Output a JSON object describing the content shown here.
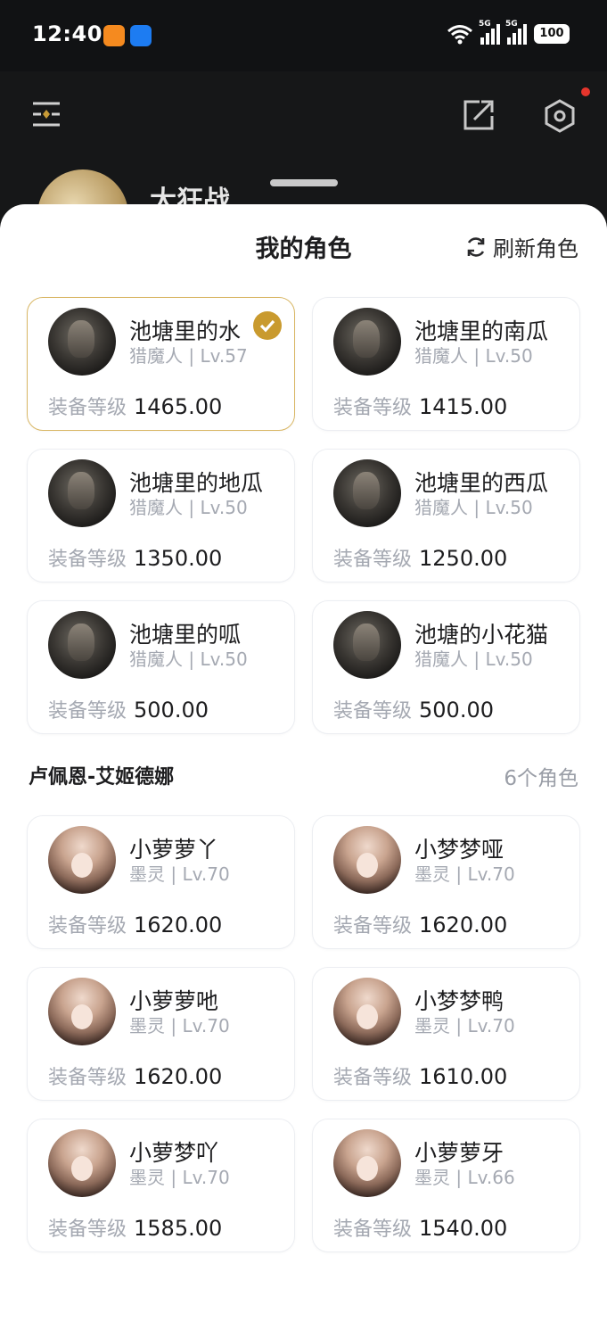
{
  "status_bar": {
    "time": "12:40",
    "signal1_label": "5G",
    "signal2_label": "5G",
    "battery": "100"
  },
  "header": {
    "profile_name": "大狂战"
  },
  "sheet": {
    "title": "我的角色",
    "refresh_label": "刷新角色",
    "equip_label": "装备等级"
  },
  "group1": {
    "characters": [
      {
        "name": "池塘里的水",
        "sub": "猎魔人 | Lv.57",
        "equip": "1465.00",
        "selected": true
      },
      {
        "name": "池塘里的南瓜",
        "sub": "猎魔人 | Lv.50",
        "equip": "1415.00"
      },
      {
        "name": "池塘里的地瓜",
        "sub": "猎魔人 | Lv.50",
        "equip": "1350.00"
      },
      {
        "name": "池塘里的西瓜",
        "sub": "猎魔人 | Lv.50",
        "equip": "1250.00"
      },
      {
        "name": "池塘里的呱",
        "sub": "猎魔人 | Lv.50",
        "equip": "500.00"
      },
      {
        "name": "池塘的小花猫",
        "sub": "猎魔人 | Lv.50",
        "equip": "500.00"
      }
    ]
  },
  "group2": {
    "server": "卢佩恩-艾姬德娜",
    "count": "6个角色",
    "characters": [
      {
        "name": "小萝萝丫",
        "sub": "墨灵 | Lv.70",
        "equip": "1620.00"
      },
      {
        "name": "小梦梦哑",
        "sub": "墨灵 | Lv.70",
        "equip": "1620.00"
      },
      {
        "name": "小萝萝吔",
        "sub": "墨灵 | Lv.70",
        "equip": "1620.00"
      },
      {
        "name": "小梦梦鸭",
        "sub": "墨灵 | Lv.70",
        "equip": "1610.00"
      },
      {
        "name": "小萝梦吖",
        "sub": "墨灵 | Lv.70",
        "equip": "1585.00"
      },
      {
        "name": "小萝萝牙",
        "sub": "墨灵 | Lv.66",
        "equip": "1540.00"
      }
    ]
  },
  "colors": {
    "selected_border": "#d9b765",
    "check_badge": "#c99a2e",
    "muted_text": "#a5a9b2"
  }
}
